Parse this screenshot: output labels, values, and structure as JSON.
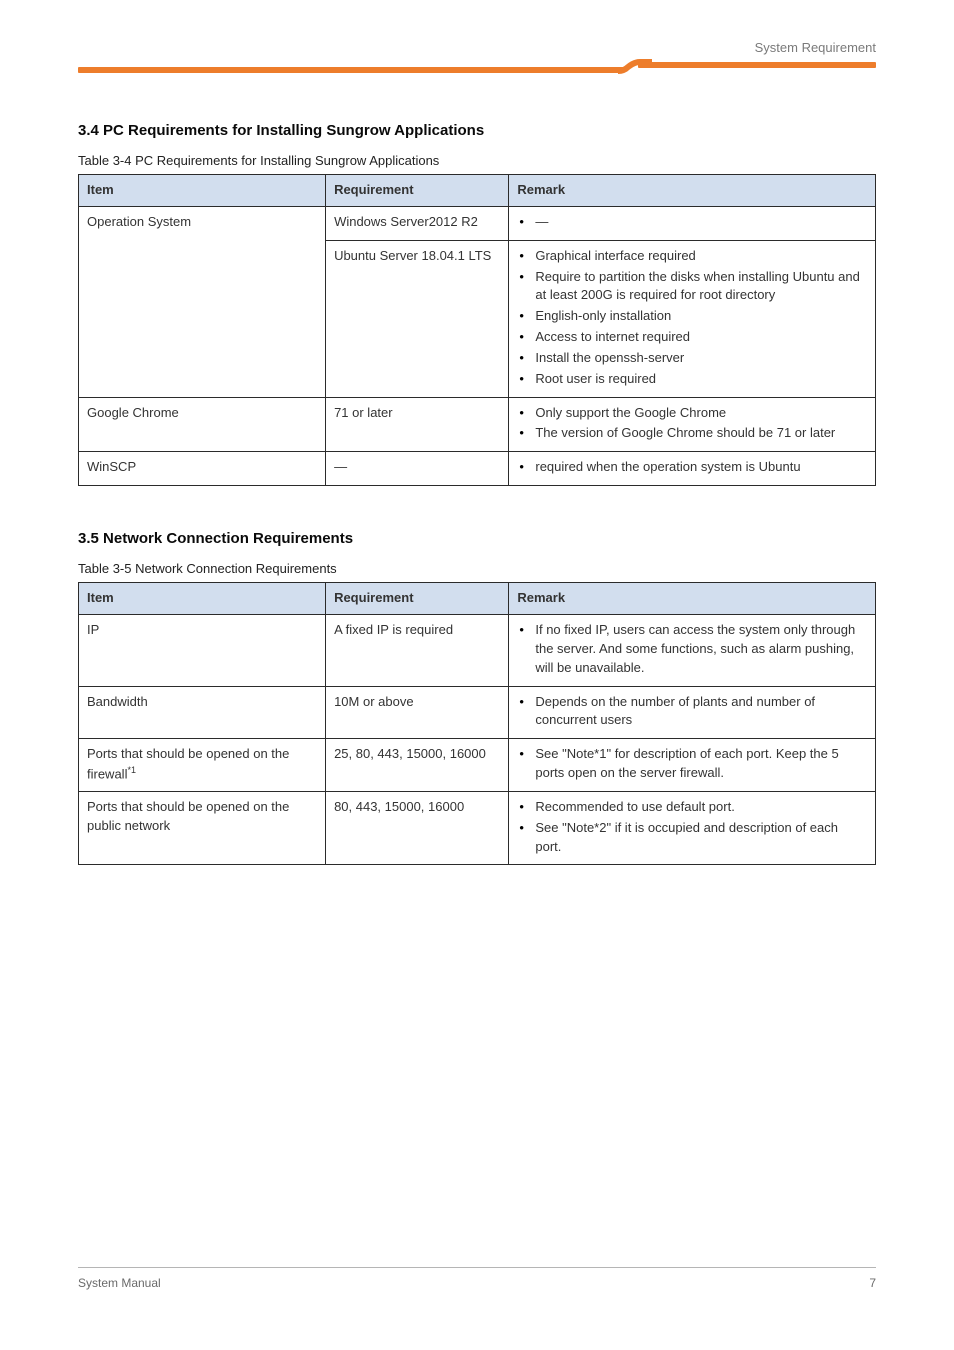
{
  "header": {
    "right_text": "System Requirement"
  },
  "sections": {
    "s34": {
      "heading": "3.4 PC Requirements for Installing Sungrow Applications",
      "caption": "Table 3-4 PC Requirements for Installing Sungrow Applications",
      "cols": [
        "Item",
        "Requirement",
        "Remark"
      ],
      "rows": [
        {
          "c1": "Operation System",
          "c2": "Windows Server2012 R2",
          "c3_items": [
            "—"
          ],
          "no_bottom": true
        },
        {
          "c1": "",
          "c2": "Ubuntu Server 18.04.1 LTS",
          "c3_items": [
            "Graphical interface required",
            "Require to partition the disks when installing Ubuntu and at least 200G is required for root directory",
            "English-only installation",
            "Access to internet required",
            "Install the openssh-server",
            "Root user is required"
          ]
        },
        {
          "c1": "Google Chrome",
          "c2": "71 or later",
          "c3_items": [
            "Only support the Google Chrome",
            "The version of Google Chrome should be 71 or later"
          ]
        },
        {
          "c1": "WinSCP",
          "c2": "—",
          "c3_items": [
            "required when the operation system is Ubuntu"
          ]
        }
      ]
    },
    "s35": {
      "heading": "3.5 Network Connection Requirements",
      "caption": "Table 3-5 Network Connection Requirements",
      "cols": [
        "Item",
        "Requirement",
        "Remark"
      ],
      "rows": [
        {
          "c1": "IP",
          "c2": "A fixed IP is required",
          "c3_items": [
            "If no fixed IP, users can access the system only through the server. And some functions, such as alarm pushing, will be unavailable."
          ]
        },
        {
          "c1": "Bandwidth",
          "c2": "10M or above",
          "c3_items": [
            "Depends on the number of plants and number of concurrent users"
          ]
        },
        {
          "c1_html": "Ports that should be opened on the firewall<span class='notemark'>*1</span>",
          "c2": "25, 80, 443, 15000, 16000",
          "c3_items": [
            "See \"Note*1\" for description of each port. Keep the 5 ports open on the server firewall."
          ]
        },
        {
          "c1": "Ports that should be opened on the public network",
          "c2": "80, 443, 15000, 16000",
          "c3_items": [
            "Recommended to use default port.",
            "See \"Note*2\" if it is occupied and description of each port."
          ]
        }
      ]
    }
  },
  "footer": {
    "left": "System Manual",
    "right": "7"
  }
}
